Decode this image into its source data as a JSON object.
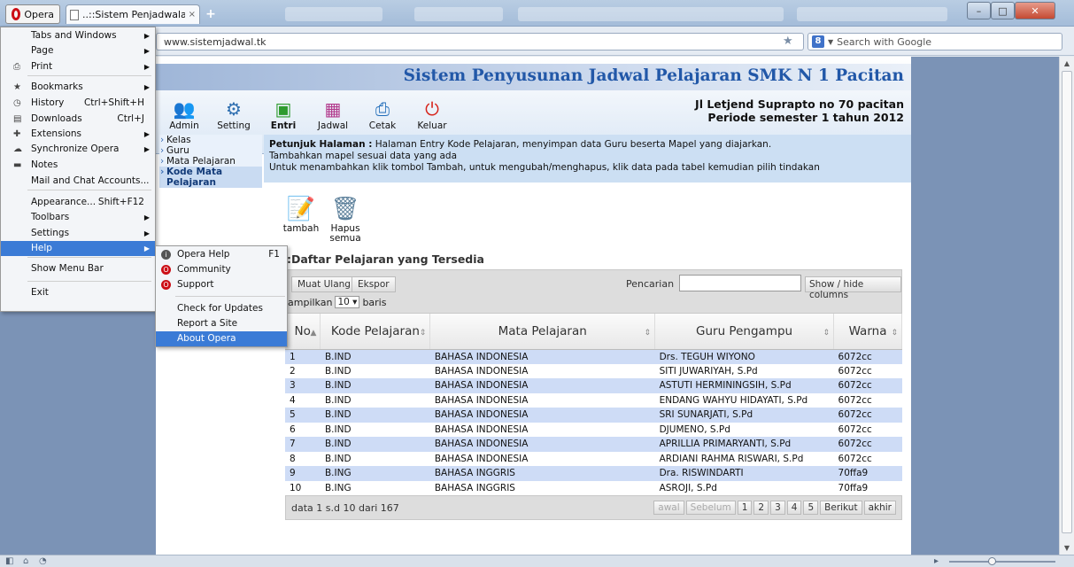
{
  "browser": {
    "opera_label": "Opera",
    "tab_title": "..::Sistem Penjadwalan ...",
    "tab_close": "×",
    "new_tab": "+",
    "url": "www.sistemjadwal.tk",
    "search_placeholder": "Search with Google",
    "search_engine": "8"
  },
  "opera_menu": {
    "items": [
      {
        "label": "Tabs and Windows",
        "shortcut": "",
        "arrow": "▶"
      },
      {
        "label": "Page",
        "shortcut": "",
        "arrow": "▶"
      },
      {
        "label": "Print",
        "shortcut": "",
        "arrow": "▶"
      },
      {
        "label": "Bookmarks",
        "shortcut": "",
        "arrow": "▶"
      },
      {
        "label": "History",
        "shortcut": "Ctrl+Shift+H",
        "arrow": ""
      },
      {
        "label": "Downloads",
        "shortcut": "Ctrl+J",
        "arrow": ""
      },
      {
        "label": "Extensions",
        "shortcut": "",
        "arrow": "▶"
      },
      {
        "label": "Synchronize Opera",
        "shortcut": "",
        "arrow": "▶"
      },
      {
        "label": "Notes",
        "shortcut": "",
        "arrow": ""
      },
      {
        "label": "Mail and Chat Accounts...",
        "shortcut": "",
        "arrow": ""
      },
      {
        "label": "Appearance...",
        "shortcut": "Shift+F12",
        "arrow": ""
      },
      {
        "label": "Toolbars",
        "shortcut": "",
        "arrow": "▶"
      },
      {
        "label": "Settings",
        "shortcut": "",
        "arrow": "▶"
      },
      {
        "label": "Help",
        "shortcut": "",
        "arrow": "▶"
      },
      {
        "label": "Show Menu Bar",
        "shortcut": "",
        "arrow": ""
      },
      {
        "label": "Exit",
        "shortcut": "",
        "arrow": ""
      }
    ]
  },
  "help_menu": {
    "items": [
      {
        "label": "Opera Help",
        "shortcut": "F1"
      },
      {
        "label": "Community",
        "shortcut": ""
      },
      {
        "label": "Support",
        "shortcut": ""
      },
      {
        "label": "Check for Updates",
        "shortcut": ""
      },
      {
        "label": "Report a Site Problem...",
        "shortcut": ""
      },
      {
        "label": "About Opera",
        "shortcut": ""
      }
    ]
  },
  "site": {
    "title": "Sistem Penyusunan Jadwal Pelajaran SMK N 1 Pacitan",
    "address_line1": "Jl Letjend Suprapto no 70 pacitan",
    "address_line2": "Periode semester 1 tahun 2012",
    "toolbar": {
      "admin": "Admin",
      "setting": "Setting",
      "entri": "Entri",
      "jadwal": "Jadwal",
      "cetak": "Cetak",
      "keluar": "Keluar"
    },
    "submenu": {
      "kelas": "Kelas",
      "guru": "Guru",
      "mapel": "Mata Pelajaran",
      "kode": "Kode Mata Pelajaran"
    },
    "hint": {
      "label": "Petunjuk Halaman :",
      "line1": " Halaman Entry Kode Pelajaran, menyimpan data Guru beserta Mapel yang diajarkan.",
      "line2": "Tambahkan mapel sesuai data yang ada",
      "line3": "Untuk menambahkan klik tombol Tambah, untuk mengubah/menghapus, klik data pada tabel kemudian pilih tindakan"
    },
    "actions": {
      "tambah": "tambah",
      "hapus": "Hapus semua"
    },
    "list_title": ":Daftar Pelajaran yang Tersedia"
  },
  "grid": {
    "reload": "Muat Ulang",
    "export": "Ekspor",
    "search_label": "Pencarian",
    "show_hide": "Show / hide columns",
    "per_page_prefix": "ampilkan",
    "per_page_value": "10",
    "per_page_suffix": "baris",
    "columns": [
      "No",
      "Kode Pelajaran",
      "Mata Pelajaran",
      "Guru Pengampu",
      "Warna"
    ],
    "rows": [
      [
        "1",
        "B.IND",
        "BAHASA INDONESIA",
        "Drs. TEGUH WIYONO",
        "6072cc"
      ],
      [
        "2",
        "B.IND",
        "BAHASA INDONESIA",
        "SITI JUWARIYAH, S.Pd",
        "6072cc"
      ],
      [
        "3",
        "B.IND",
        "BAHASA INDONESIA",
        "ASTUTI HERMININGSIH, S.Pd",
        "6072cc"
      ],
      [
        "4",
        "B.IND",
        "BAHASA INDONESIA",
        "ENDANG WAHYU HIDAYATI, S.Pd",
        "6072cc"
      ],
      [
        "5",
        "B.IND",
        "BAHASA INDONESIA",
        "SRI SUNARJATI, S.Pd",
        "6072cc"
      ],
      [
        "6",
        "B.IND",
        "BAHASA INDONESIA",
        "DJUMENO, S.Pd",
        "6072cc"
      ],
      [
        "7",
        "B.IND",
        "BAHASA INDONESIA",
        "APRILLIA PRIMARYANTI, S.Pd",
        "6072cc"
      ],
      [
        "8",
        "B.IND",
        "BAHASA INDONESIA",
        "ARDIANI RAHMA RISWARI, S.Pd",
        "6072cc"
      ],
      [
        "9",
        "B.ING",
        "BAHASA INGGRIS",
        "Dra. RISWINDARTI",
        "70ffa9"
      ],
      [
        "10",
        "B.ING",
        "BAHASA INGGRIS",
        "ASROJI, S.Pd",
        "70ffa9"
      ]
    ],
    "footer_info": "data 1 s.d 10 dari 167",
    "pager": [
      "awal",
      "Sebelum",
      "1",
      "2",
      "3",
      "4",
      "5",
      "Berikut",
      "akhir"
    ]
  },
  "colors": {
    "title_blue": "#2258a8",
    "row_stripe": "#cedcf6",
    "menu_highlight": "#3b7bd6",
    "opera_red": "#cc0f16"
  }
}
